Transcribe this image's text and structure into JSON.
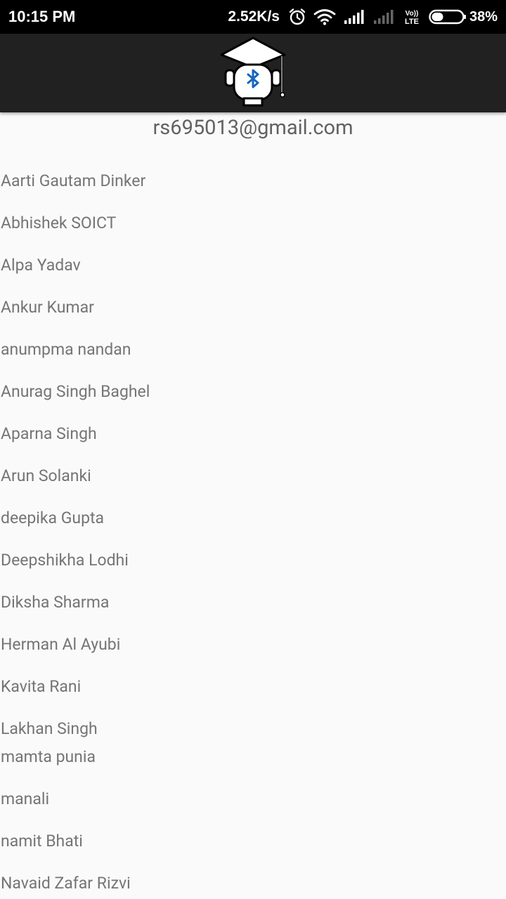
{
  "status_bar": {
    "time": "10:15 PM",
    "network_speed": "2.52K/s",
    "volte_top": "Vo))",
    "volte_bottom": "LTE",
    "battery_percent": "38%",
    "battery_level": 0.38,
    "icons": [
      "alarm-icon",
      "wifi-icon",
      "signal-icon",
      "signal-weak-icon",
      "volte-icon",
      "battery-icon"
    ]
  },
  "app_bar": {
    "logo_icon": "graduation-cap-bluetooth-icon",
    "background": "#212121",
    "accent": "#1565c0"
  },
  "account": {
    "email": "rs695013@gmail.com"
  },
  "contacts": [
    "Aarti Gautam Dinker",
    "Abhishek SOICT",
    "Alpa Yadav",
    "Ankur Kumar",
    "anumpma nandan",
    "Anurag Singh Baghel",
    "Aparna Singh",
    "Arun Solanki",
    "deepika Gupta",
    "Deepshikha Lodhi",
    "Diksha Sharma",
    "Herman Al Ayubi",
    "Kavita Rani",
    "Lakhan Singh",
    "mamta punia",
    "manali",
    "namit Bhati",
    "Navaid Zafar Rizvi"
  ]
}
